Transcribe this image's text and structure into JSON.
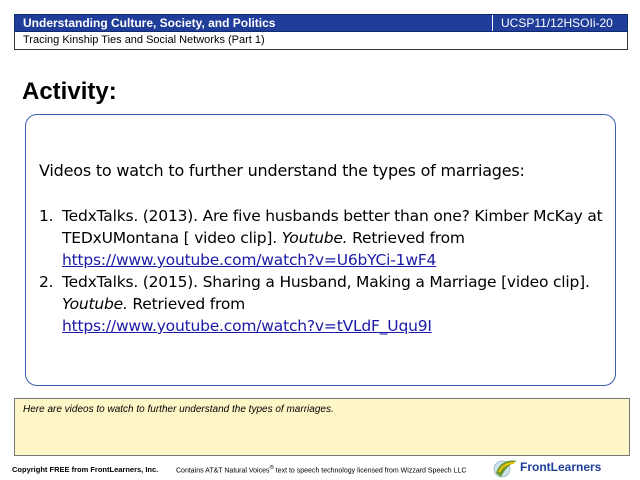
{
  "header": {
    "course_title": "Understanding Culture, Society, and Politics",
    "code": "UCSP11/12HSOIi-20",
    "lesson_title": "Tracing Kinship Ties and Social Networks (Part 1)"
  },
  "slide": {
    "heading": "Activity:",
    "intro": "Videos to watch to further understand the types of marriages:",
    "references": [
      {
        "number": "1.",
        "citation": "TedxTalks. (2013). Are five husbands better than one? Kimber McKay at TEDxUMontana [ video clip]. ",
        "source": "Youtube.",
        "retrieved": " Retrieved from",
        "link": "https://www.youtube.com/watch?v=U6bYCi-1wF4"
      },
      {
        "number": "2.",
        "citation": "TedxTalks. (2015). Sharing a Husband, Making a Marriage [video clip]. ",
        "source": "Youtube.",
        "retrieved": " Retrieved from",
        "link": "https://www.youtube.com/watch?v=tVLdF_Uqu9I"
      }
    ]
  },
  "notes": {
    "text": "Here are videos to watch to further understand the types of marriages."
  },
  "footer": {
    "copyright": "Copyright FREE from FrontLearners, Inc.",
    "tts_prefix": "Contains AT&T Natural Voices",
    "tts_mark": "®",
    "tts_suffix": " text to speech technology licensed from Wizzard Speech LLC",
    "brand": "FrontLearners"
  },
  "colors": {
    "header_bg": "#1f3d99",
    "link": "#1a1aa8",
    "notes_bg": "#fff6c8",
    "box_border": "#3a5fb0"
  }
}
